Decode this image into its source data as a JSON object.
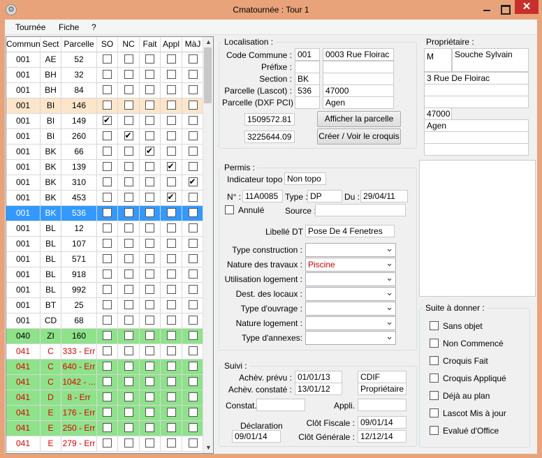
{
  "window": {
    "title": "Cmatournée : Tour 1",
    "app_icon": "gear-icon",
    "close_glyph": "✕"
  },
  "menu": [
    "Tournée",
    "Fiche",
    "?"
  ],
  "grid": {
    "columns": [
      "Commun",
      "Sect",
      "Parcelle",
      "SO",
      "NC",
      "Fait",
      "Appl",
      "MàJ"
    ],
    "rows": [
      {
        "commun": "001",
        "sect": "AE",
        "parcelle": "52",
        "so": false,
        "nc": false,
        "fait": false,
        "appl": false,
        "maj": false,
        "style": "normal"
      },
      {
        "commun": "001",
        "sect": "BH",
        "parcelle": "32",
        "so": false,
        "nc": false,
        "fait": false,
        "appl": false,
        "maj": false,
        "style": "normal"
      },
      {
        "commun": "001",
        "sect": "BH",
        "parcelle": "84",
        "so": false,
        "nc": false,
        "fait": false,
        "appl": false,
        "maj": false,
        "style": "normal"
      },
      {
        "commun": "001",
        "sect": "BI",
        "parcelle": "146",
        "so": false,
        "nc": false,
        "fait": false,
        "appl": false,
        "maj": false,
        "style": "peach"
      },
      {
        "commun": "001",
        "sect": "BI",
        "parcelle": "149",
        "so": true,
        "nc": false,
        "fait": false,
        "appl": false,
        "maj": false,
        "style": "normal"
      },
      {
        "commun": "001",
        "sect": "BI",
        "parcelle": "260",
        "so": false,
        "nc": true,
        "fait": false,
        "appl": false,
        "maj": false,
        "style": "normal"
      },
      {
        "commun": "001",
        "sect": "BK",
        "parcelle": "66",
        "so": false,
        "nc": false,
        "fait": true,
        "appl": false,
        "maj": false,
        "style": "normal"
      },
      {
        "commun": "001",
        "sect": "BK",
        "parcelle": "139",
        "so": false,
        "nc": false,
        "fait": false,
        "appl": true,
        "maj": false,
        "style": "normal"
      },
      {
        "commun": "001",
        "sect": "BK",
        "parcelle": "310",
        "so": false,
        "nc": false,
        "fait": false,
        "appl": false,
        "maj": true,
        "style": "normal"
      },
      {
        "commun": "001",
        "sect": "BK",
        "parcelle": "453",
        "so": false,
        "nc": false,
        "fait": false,
        "appl": true,
        "maj": false,
        "style": "normal"
      },
      {
        "commun": "001",
        "sect": "BK",
        "parcelle": "536",
        "so": false,
        "nc": false,
        "fait": false,
        "appl": false,
        "maj": false,
        "style": "selected"
      },
      {
        "commun": "001",
        "sect": "BL",
        "parcelle": "12",
        "so": false,
        "nc": false,
        "fait": false,
        "appl": false,
        "maj": false,
        "style": "normal"
      },
      {
        "commun": "001",
        "sect": "BL",
        "parcelle": "107",
        "so": false,
        "nc": false,
        "fait": false,
        "appl": false,
        "maj": false,
        "style": "normal"
      },
      {
        "commun": "001",
        "sect": "BL",
        "parcelle": "571",
        "so": false,
        "nc": false,
        "fait": false,
        "appl": false,
        "maj": false,
        "style": "normal"
      },
      {
        "commun": "001",
        "sect": "BL",
        "parcelle": "918",
        "so": false,
        "nc": false,
        "fait": false,
        "appl": false,
        "maj": false,
        "style": "normal"
      },
      {
        "commun": "001",
        "sect": "BL",
        "parcelle": "992",
        "so": false,
        "nc": false,
        "fait": false,
        "appl": false,
        "maj": false,
        "style": "normal"
      },
      {
        "commun": "001",
        "sect": "BT",
        "parcelle": "25",
        "so": false,
        "nc": false,
        "fait": false,
        "appl": false,
        "maj": false,
        "style": "normal"
      },
      {
        "commun": "001",
        "sect": "CD",
        "parcelle": "68",
        "so": false,
        "nc": false,
        "fait": false,
        "appl": false,
        "maj": false,
        "style": "normal"
      },
      {
        "commun": "040",
        "sect": "ZI",
        "parcelle": "160",
        "so": false,
        "nc": false,
        "fait": false,
        "appl": false,
        "maj": false,
        "style": "green"
      },
      {
        "commun": "041",
        "sect": "C",
        "parcelle": "333 - Err",
        "so": false,
        "nc": false,
        "fait": false,
        "appl": false,
        "maj": false,
        "style": "err"
      },
      {
        "commun": "041",
        "sect": "C",
        "parcelle": "640 - Err",
        "so": false,
        "nc": false,
        "fait": false,
        "appl": false,
        "maj": false,
        "style": "green-err"
      },
      {
        "commun": "041",
        "sect": "C",
        "parcelle": "1042 - ...",
        "so": false,
        "nc": false,
        "fait": false,
        "appl": false,
        "maj": false,
        "style": "green-err"
      },
      {
        "commun": "041",
        "sect": "D",
        "parcelle": "8 - Err",
        "so": false,
        "nc": false,
        "fait": false,
        "appl": false,
        "maj": false,
        "style": "green-err"
      },
      {
        "commun": "041",
        "sect": "E",
        "parcelle": "176 - Err",
        "so": false,
        "nc": false,
        "fait": false,
        "appl": false,
        "maj": false,
        "style": "green-err"
      },
      {
        "commun": "041",
        "sect": "E",
        "parcelle": "250 - Err",
        "so": false,
        "nc": false,
        "fait": false,
        "appl": false,
        "maj": false,
        "style": "green-err"
      },
      {
        "commun": "041",
        "sect": "E",
        "parcelle": "279 - Err",
        "so": false,
        "nc": false,
        "fait": false,
        "appl": false,
        "maj": false,
        "style": "err"
      }
    ]
  },
  "localisation": {
    "title": "Localisation :",
    "code_commune_label": "Code Commune :",
    "code_commune": "001",
    "adresse": "0003 Rue Floirac",
    "prefixe_label": "Préfixe :",
    "prefixe": "",
    "section_label": "Section :",
    "section": "BK",
    "parcelle_lascot_label": "Parcelle (Lascot) :",
    "parcelle_lascot": "536",
    "code_postal": "47000",
    "parcelle_dxf_label": "Parcelle (DXF PCI) :",
    "parcelle_dxf": "",
    "ville": "Agen",
    "coord_x": "1509572.81",
    "coord_y": "3225644.09",
    "afficher_button": "Afficher la parcelle",
    "croquis_button": "Créer / Voir le croquis"
  },
  "proprietaire": {
    "title": "Propriétaire :",
    "civilite": "M",
    "nom": "Souche Sylvain",
    "adresse": "3 Rue De Floirac",
    "code_postal": "47000",
    "ville": "Agen"
  },
  "permis": {
    "title": "Permis :",
    "indicateur_label": "Indicateur topo :",
    "indicateur": "Non topo",
    "numero_label": "N° :",
    "numero": "11A0085",
    "type_label": "Type :",
    "type": "DP",
    "du_label": "Du :",
    "du": "29/04/11",
    "annule_label": "Annulé",
    "annule": false,
    "source_label": "Source :",
    "source": "",
    "libelle_label": "Libellé DT :",
    "libelle": "Pose De 4 Fenetres",
    "selects": [
      {
        "label": "Type construction :",
        "value": ""
      },
      {
        "label": "Nature des travaux :",
        "value": "Piscine",
        "color": "#cc0000"
      },
      {
        "label": "Utilisation logement :",
        "value": ""
      },
      {
        "label": "Dest. des locaux :",
        "value": ""
      },
      {
        "label": "Type d'ouvrage :",
        "value": ""
      },
      {
        "label": "Nature logement :",
        "value": ""
      },
      {
        "label": "Type d'annexes:",
        "value": ""
      }
    ]
  },
  "suivi": {
    "title": "Suivi :",
    "achev_prevu_label": "Achèv. prévu :",
    "achev_prevu": "01/01/13",
    "achev_prevu_source": "CDIF",
    "achev_constate_label": "Achèv. constaté :",
    "achev_constate": "13/01/12",
    "achev_constate_source": "Propriétaire",
    "constat_label": "Constat. :",
    "constat": "",
    "appli_label": "Appli. :",
    "appli": "",
    "declaration_label": "Déclaration",
    "declaration": "09/01/14",
    "clot_fiscale_label": "Clôt Fiscale :",
    "clot_fiscale": "09/01/14",
    "clot_generale_label": "Clôt Générale :",
    "clot_generale": "12/12/14"
  },
  "suite": {
    "title": "Suite à donner :",
    "options": [
      "Sans objet",
      "Non Commencé",
      "Croquis Fait",
      "Croquis Appliqué",
      "Déjà au plan",
      "Lascot Mis à jour",
      "Evalué d'Office"
    ]
  },
  "colors": {
    "selected": "#3399ff",
    "peach": "#fde5c9",
    "green": "#8ee28a",
    "error_text": "#dd0000"
  }
}
